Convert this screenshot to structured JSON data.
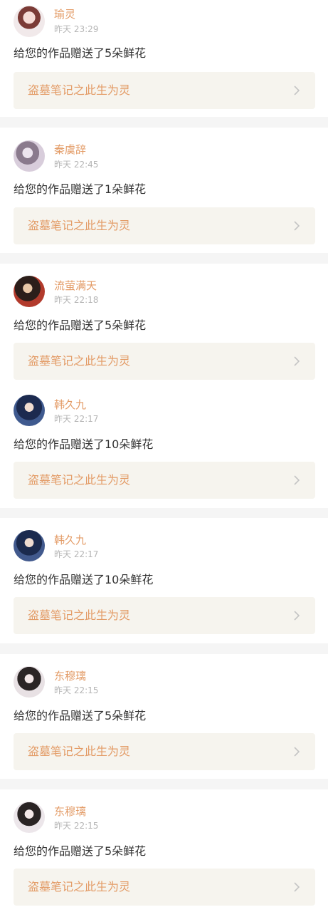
{
  "notifications": [
    {
      "avatar": "avatar-girl-red-hair",
      "user": "瑜灵",
      "time": "昨天 23:29",
      "message": "给您的作品赠送了5朵鲜花",
      "work": "盗墓笔记之此生为灵"
    },
    {
      "avatar": "avatar-girl-lavender",
      "user": "秦虞辞",
      "time": "昨天 22:45",
      "message": "给您的作品赠送了1朵鲜花",
      "work": "盗墓笔记之此生为灵"
    },
    {
      "avatar": "avatar-dark-red-flowers",
      "user": "流萤满天",
      "time": "昨天 22:18",
      "message": "给您的作品赠送了5朵鲜花",
      "work": "盗墓笔记之此生为灵"
    },
    {
      "avatar": "avatar-boy-blue-hair",
      "user": "韩久九",
      "time": "昨天 22:17",
      "message": "给您的作品赠送了10朵鲜花",
      "work": "盗墓笔记之此生为灵"
    },
    {
      "avatar": "avatar-boy-blue-hair",
      "user": "韩久九",
      "time": "昨天 22:17",
      "message": "给您的作品赠送了10朵鲜花",
      "work": "盗墓笔记之此生为灵"
    },
    {
      "avatar": "avatar-girl-dark-hair",
      "user": "东穆璃",
      "time": "昨天 22:15",
      "message": "给您的作品赠送了5朵鲜花",
      "work": "盗墓笔记之此生为灵"
    },
    {
      "avatar": "avatar-girl-dark-hair",
      "user": "东穆璃",
      "time": "昨天 22:15",
      "message": "给您的作品赠送了5朵鲜花",
      "work": "盗墓笔记之此生为灵"
    }
  ],
  "colors": {
    "accent": "#e39b66",
    "background": "#f5f5f5",
    "card": "#ffffff",
    "work_link_bg": "#f6f4ee",
    "timestamp": "#b5b5b5",
    "message": "#333333"
  },
  "icons": {
    "chevron": "chevron-right-icon"
  }
}
